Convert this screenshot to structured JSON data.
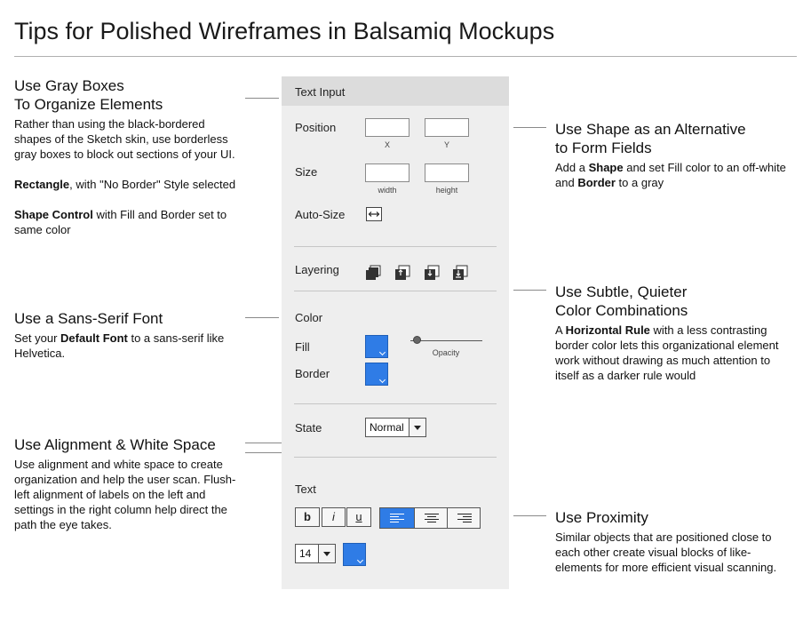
{
  "title": "Tips for Polished Wireframes in Balsamiq Mockups",
  "tips": {
    "gray_boxes": {
      "heading_line1": "Use Gray Boxes",
      "heading_line2": "To Organize Elements",
      "p1": "Rather than using the black-bordered shapes of the Sketch skin, use borderless gray boxes to block out sections of your UI.",
      "p2_bold": "Rectangle",
      "p2_rest": ", with \"No Border\" Style selected",
      "p3_bold": "Shape Control",
      "p3_rest": " with Fill and Border set to same color"
    },
    "sans_serif": {
      "heading": "Use a Sans-Serif Font",
      "p_pre": "Set your ",
      "p_bold": "Default Font",
      "p_post": " to a sans-serif like Helvetica."
    },
    "alignment": {
      "heading": "Use Alignment & White Space",
      "p": "Use alignment and white space to create organization and help the user scan. Flush-left alignment of labels on the left and settings in the right column help direct the path the eye takes."
    },
    "shape": {
      "heading_line1": "Use Shape as an Alternative",
      "heading_line2": "to Form Fields",
      "p_pre": "Add a ",
      "p_bold1": "Shape",
      "p_mid": " and set Fill color to an off-white and ",
      "p_bold2": "Border",
      "p_post": " to a gray"
    },
    "subtle": {
      "heading_line1": "Use Subtle, Quieter",
      "heading_line2": "Color Combinations",
      "p_pre": "A ",
      "p_bold": "Horizontal Rule",
      "p_post": " with a less contrasting border color lets this organizational element work without drawing as much attention to itself as a darker rule would"
    },
    "proximity": {
      "heading": "Use Proximity",
      "p": "Similar objects that are positioned close to each other create visual blocks of like-elements for more efficient visual scanning."
    }
  },
  "panel": {
    "header": "Text Input",
    "position_label": "Position",
    "x_label": "X",
    "y_label": "Y",
    "size_label": "Size",
    "width_label": "width",
    "height_label": "height",
    "autosize_label": "Auto-Size",
    "layering_label": "Layering",
    "color_label": "Color",
    "fill_label": "Fill",
    "border_label": "Border",
    "opacity_label": "Opacity",
    "opacity_value": 0.05,
    "state_label": "State",
    "state_value": "Normal",
    "text_label": "Text",
    "bold_label": "b",
    "italic_label": "i",
    "underline_label": "u",
    "font_size_value": "14",
    "alignment_selected": "left"
  },
  "colors": {
    "swatch_blue": "#2f7ce6",
    "panel_bg": "#eeeeee",
    "panel_header_bg": "#dcdcdc"
  },
  "icons": [
    "resize-horizontal-icon",
    "bring-to-front-icon",
    "bring-forward-icon",
    "send-backward-icon",
    "send-to-back-icon",
    "chevron-down-icon",
    "align-left-icon",
    "align-center-icon",
    "align-right-icon"
  ]
}
